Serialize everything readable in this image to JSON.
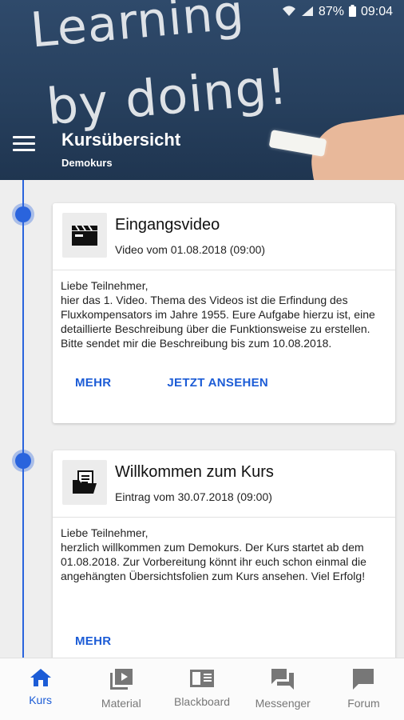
{
  "status_bar": {
    "battery": "87%",
    "time": "09:04"
  },
  "header": {
    "chalk_line_1": "Learning",
    "chalk_line_2": "by doing!",
    "title": "Kursübersicht",
    "subtitle": "Demokurs"
  },
  "cards": [
    {
      "title": "Eingangsvideo",
      "meta": "Video vom 01.08.2018 (09:00)",
      "body": "Liebe Teilnehmer,\nhier das 1. Video. Thema des Videos ist die Erfindung des Fluxkompensators im Jahre 1955. Eure Aufgabe hierzu ist, eine detaillierte Beschreibung über die Funktionsweise zu erstellen. Bitte sendet mir die Beschreibung bis zum 10.08.2018.",
      "action_more": "MEHR",
      "action_watch": "JETZT ANSEHEN",
      "icon": "video-clapper-icon"
    },
    {
      "title": "Willkommen zum Kurs",
      "meta": "Eintrag vom 30.07.2018 (09:00)",
      "body": "Liebe Teilnehmer,\nherzlich willkommen zum Demokurs. Der Kurs startet ab dem 01.08.2018. Zur Vorbereitung könnt ihr euch schon einmal die angehängten Übersichtsfolien zum Kurs ansehen. Viel Erfolg!",
      "action_more": "MEHR",
      "icon": "folder-document-icon"
    }
  ],
  "bottom_nav": [
    {
      "label": "Kurs",
      "icon": "home-icon",
      "active": true
    },
    {
      "label": "Material",
      "icon": "video-library-icon",
      "active": false
    },
    {
      "label": "Blackboard",
      "icon": "book-icon",
      "active": false
    },
    {
      "label": "Messenger",
      "icon": "chat-bubbles-icon",
      "active": false
    },
    {
      "label": "Forum",
      "icon": "chat-icon",
      "active": false
    }
  ],
  "colors": {
    "accent": "#1c5cd6",
    "timeline": "#2a64dd",
    "header": "#2f4a6b"
  }
}
